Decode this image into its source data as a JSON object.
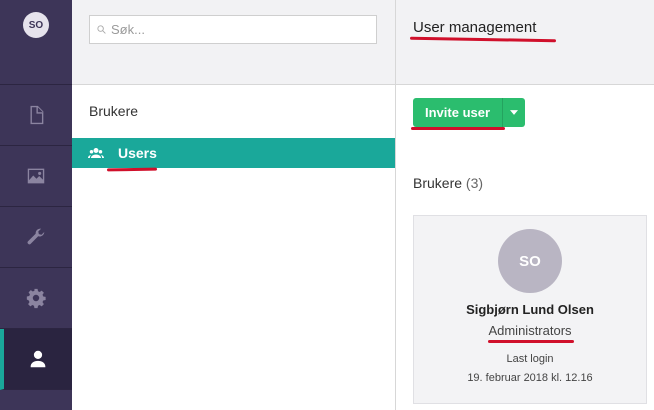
{
  "rail": {
    "avatar_initials": "SO",
    "items": [
      {
        "icon": "document-icon",
        "active": false
      },
      {
        "icon": "image-icon",
        "active": false
      },
      {
        "icon": "wrench-icon",
        "active": false
      },
      {
        "icon": "gear-icon",
        "active": false
      },
      {
        "icon": "user-icon",
        "active": true
      }
    ]
  },
  "tree": {
    "search_placeholder": "Søk...",
    "section_title": "Brukere",
    "selected_node": "Users"
  },
  "main": {
    "title": "User management",
    "invite_label": "Invite user",
    "users_heading": "Brukere",
    "users_count": "(3)",
    "card": {
      "initials": "SO",
      "name": "Sigbjørn Lund Olsen",
      "group": "Administrators",
      "last_login_label": "Last login",
      "last_login_value": "19. februar 2018 kl. 12.16"
    }
  },
  "colors": {
    "rail_bg": "#3d3558",
    "accent_teal": "#1aa89a",
    "button_green": "#2bbd6e",
    "annotation_red": "#d0102b"
  }
}
